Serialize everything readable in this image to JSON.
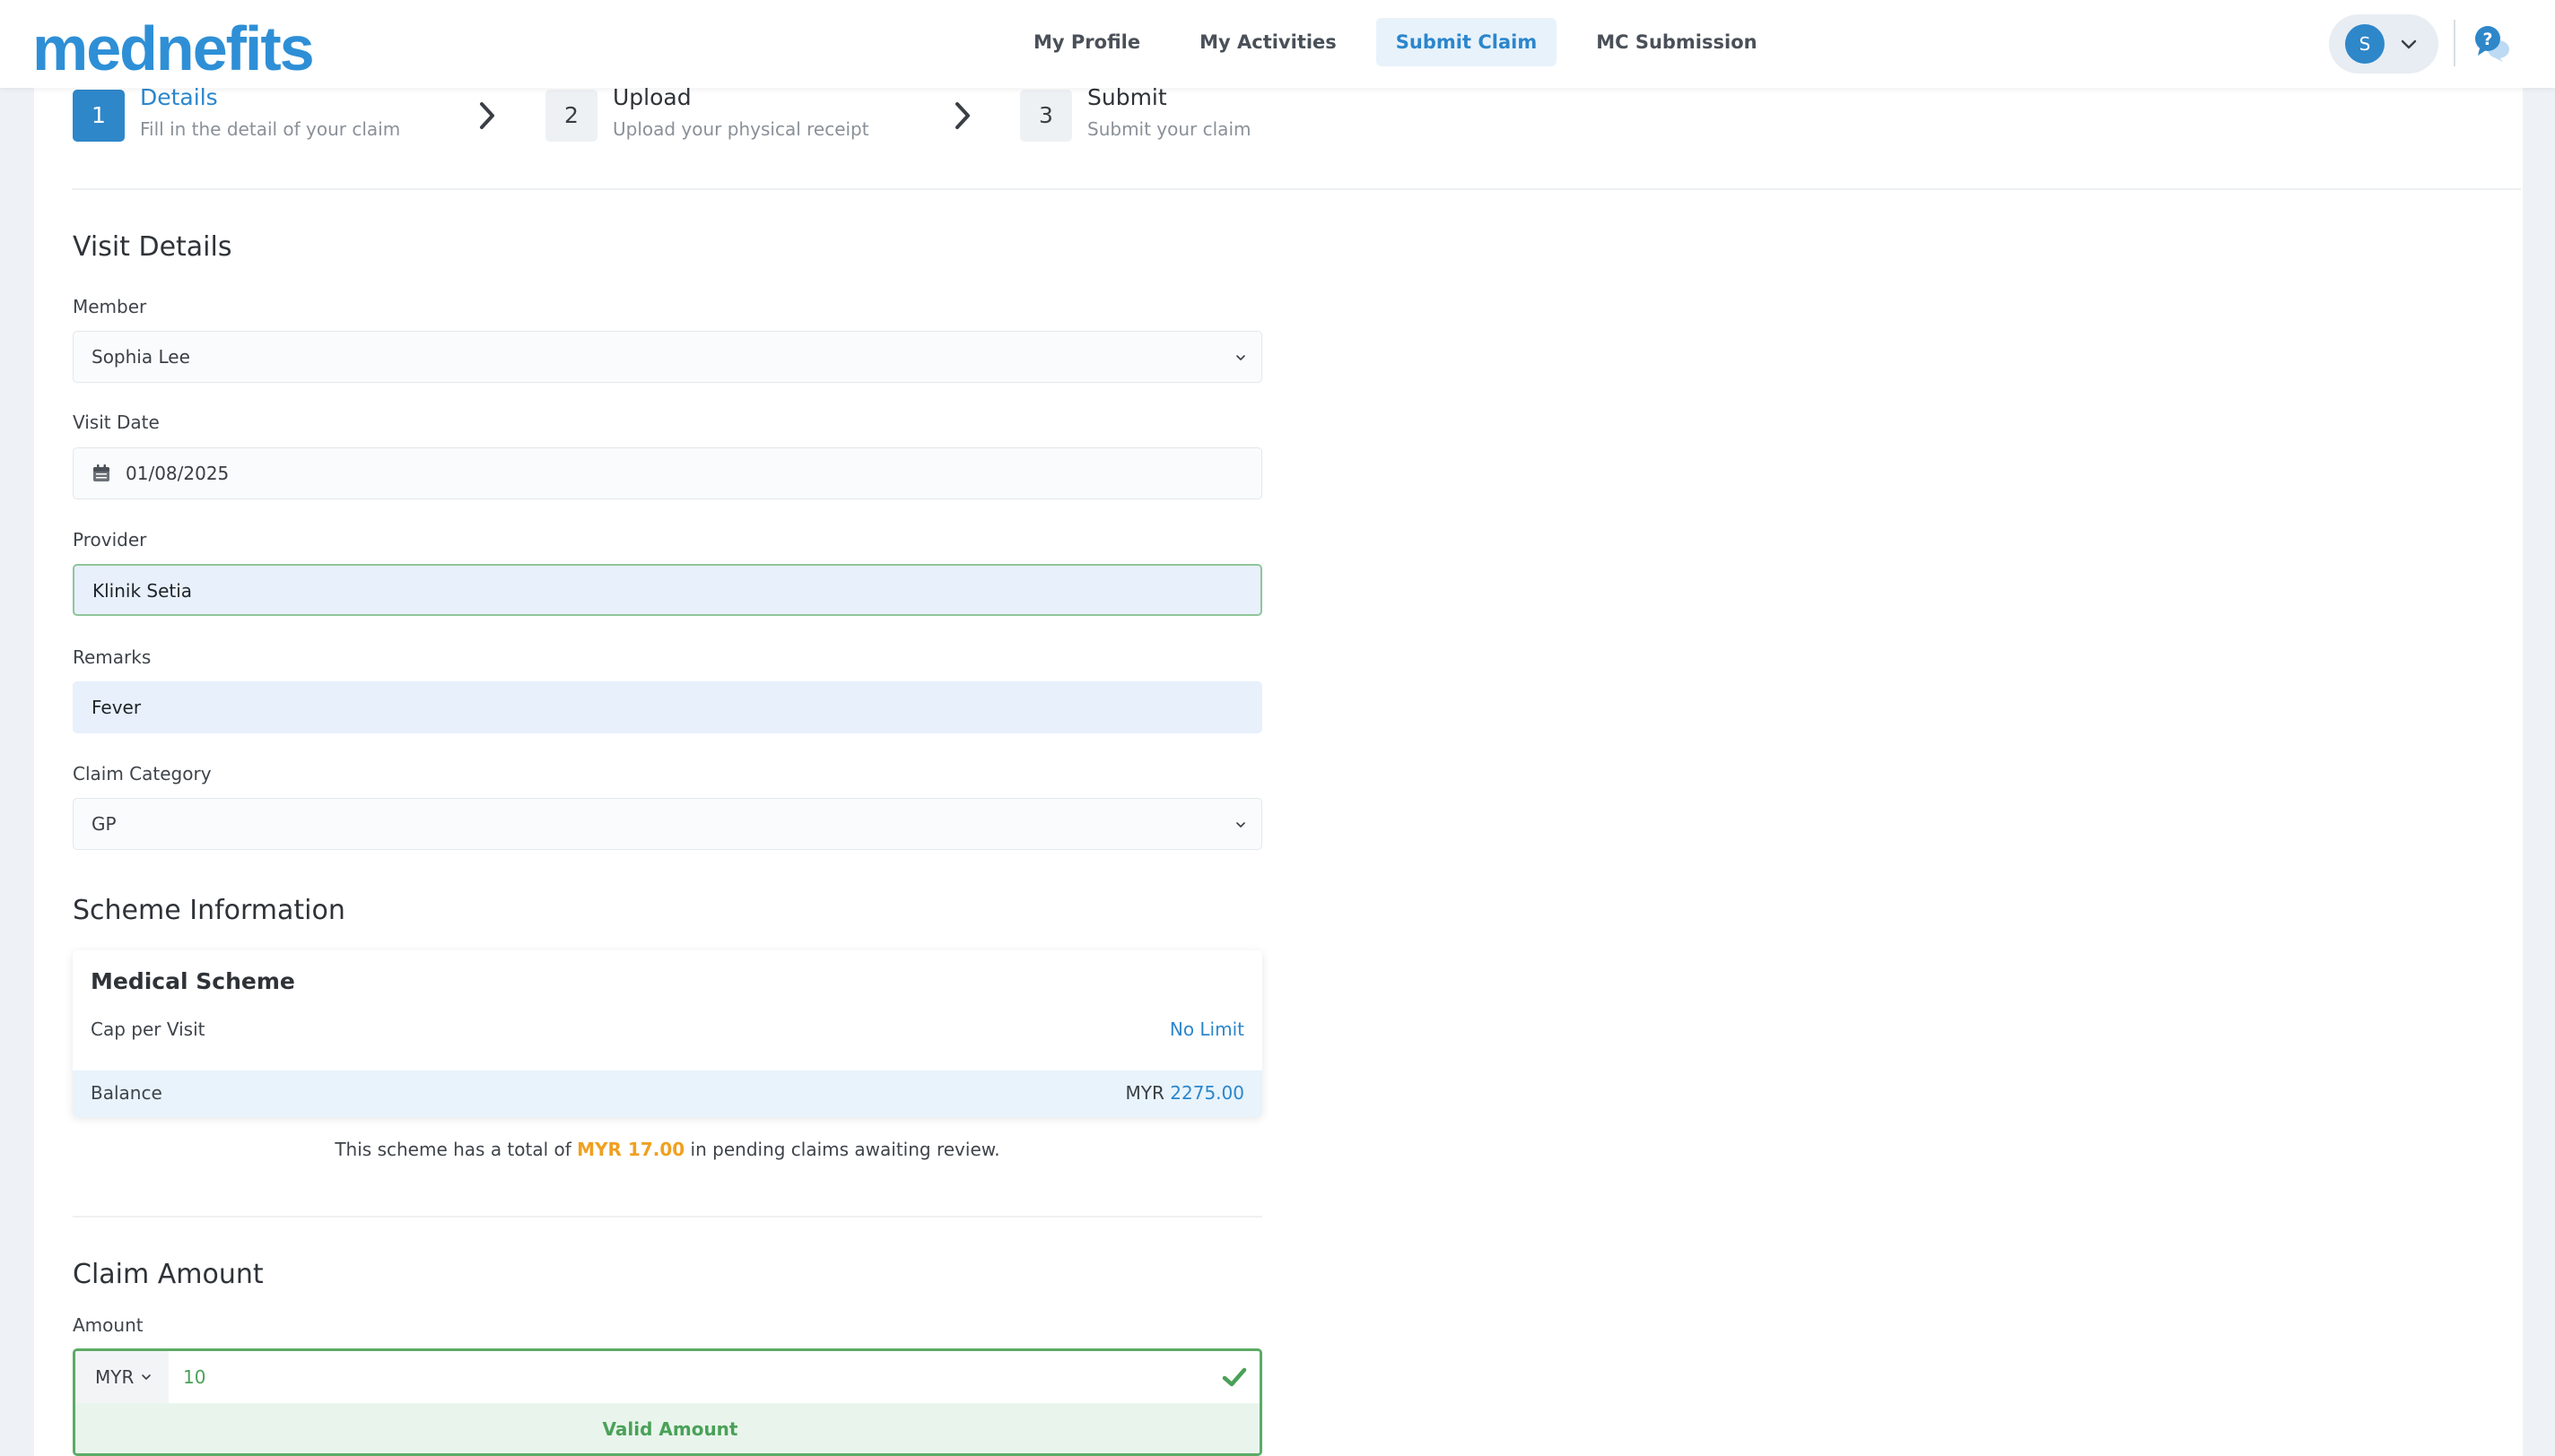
{
  "brand": {
    "logo_text": "mednefits",
    "accent": "#2e87c9",
    "success": "#5bab66",
    "warning": "#f0a020"
  },
  "nav": {
    "items": [
      {
        "label": "My Profile"
      },
      {
        "label": "My Activities"
      },
      {
        "label": "Submit Claim",
        "active": true
      },
      {
        "label": "MC Submission"
      }
    ]
  },
  "user": {
    "avatar_initial": "S"
  },
  "steps": [
    {
      "number": "1",
      "title": "Details",
      "subtitle": "Fill in the detail of your claim",
      "active": true
    },
    {
      "number": "2",
      "title": "Upload",
      "subtitle": "Upload your physical receipt"
    },
    {
      "number": "3",
      "title": "Submit",
      "subtitle": "Submit your claim"
    }
  ],
  "visit_details": {
    "title": "Visit Details",
    "member": {
      "label": "Member",
      "value": "Sophia Lee"
    },
    "visit_date": {
      "label": "Visit Date",
      "value": "01/08/2025"
    },
    "provider": {
      "label": "Provider",
      "value": "Klinik Setia"
    },
    "remarks": {
      "label": "Remarks",
      "value": "Fever"
    },
    "claim_category": {
      "label": "Claim Category",
      "value": "GP"
    }
  },
  "scheme": {
    "title": "Scheme Information",
    "card_title": "Medical Scheme",
    "cap_label": "Cap per Visit",
    "cap_value": "No Limit",
    "balance_label": "Balance",
    "balance_currency": "MYR",
    "balance_amount": "2275.00",
    "pending_prefix": "This scheme has a total of",
    "pending_amount": "MYR 17.00",
    "pending_suffix": "in pending claims awaiting review."
  },
  "claim_amount": {
    "title": "Claim Amount",
    "label": "Amount",
    "currency": "MYR",
    "value": "10",
    "validation": "Valid Amount"
  }
}
